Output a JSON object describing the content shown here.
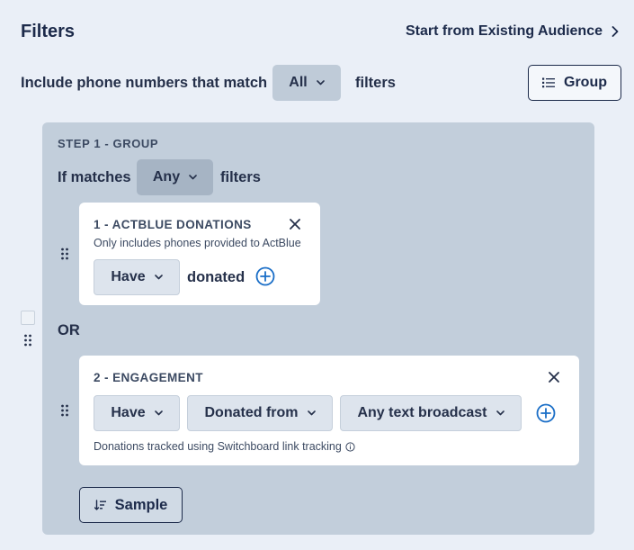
{
  "header": {
    "title": "Filters",
    "start_link": "Start from Existing Audience"
  },
  "match_row": {
    "prefix": "Include phone numbers that match",
    "selected": "All",
    "suffix": "filters",
    "group_button": "Group"
  },
  "step": {
    "title": "STEP 1 - GROUP",
    "prefix": "If matches",
    "selected": "Any",
    "suffix": "filters",
    "or_label": "OR",
    "sample_button": "Sample",
    "filters": [
      {
        "title": "1 - ACTBLUE DONATIONS",
        "subtitle": "Only includes phones provided to ActBlue",
        "have": "Have",
        "text": "donated"
      },
      {
        "title": "2 - ENGAGEMENT",
        "have": "Have",
        "action": "Donated from",
        "source": "Any text broadcast",
        "note": "Donations tracked using Switchboard link tracking"
      }
    ]
  },
  "icons": {
    "chevron": "chevron-down-icon",
    "close": "close-icon",
    "add": "plus-circle-icon",
    "drag": "drag-handle-icon",
    "info": "info-icon",
    "group": "list-icon",
    "sample": "sort-icon"
  },
  "colors": {
    "accent": "#1a6ec7",
    "text": "#1c2a4a",
    "panel": "#c2cedb"
  }
}
